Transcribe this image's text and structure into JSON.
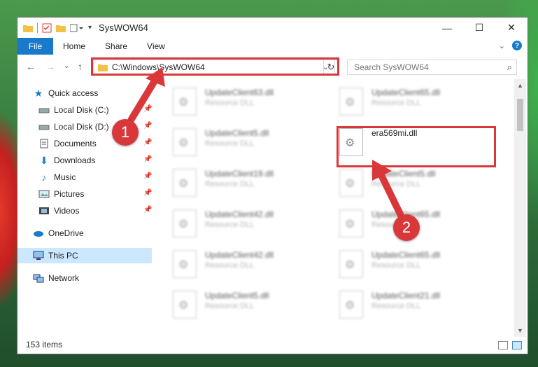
{
  "window": {
    "title": "SysWOW64",
    "buttons": {
      "minimize": "—",
      "maximize": "☐",
      "close": "✕"
    }
  },
  "ribbon": {
    "tabs": [
      "File",
      "Home",
      "Share",
      "View"
    ]
  },
  "address": {
    "path": "C:\\Windows\\SysWOW64",
    "search_placeholder": "Search SysWOW64"
  },
  "nav": {
    "items": [
      {
        "label": "Quick access",
        "icon": "star-icon"
      },
      {
        "label": "Local Disk (C:)",
        "icon": "drive-icon"
      },
      {
        "label": "Local Disk (D:)",
        "icon": "drive-icon"
      },
      {
        "label": "Documents",
        "icon": "documents-icon"
      },
      {
        "label": "Downloads",
        "icon": "downloads-icon"
      },
      {
        "label": "Music",
        "icon": "music-icon"
      },
      {
        "label": "Pictures",
        "icon": "pictures-icon"
      },
      {
        "label": "Videos",
        "icon": "videos-icon"
      },
      {
        "label": "OneDrive",
        "icon": "cloud-icon"
      },
      {
        "label": "This PC",
        "icon": "computer-icon"
      },
      {
        "label": "Network",
        "icon": "network-icon"
      }
    ]
  },
  "files": [
    {
      "name": "UpdateClient63.dll",
      "type": "Resource DLL"
    },
    {
      "name": "UpdateClient65.dll",
      "type": "Resource DLL"
    },
    {
      "name": "UpdateClient5.dll",
      "type": "Resource DLL"
    },
    {
      "name": "era569mi.dll",
      "type": ""
    },
    {
      "name": "UpdateClient19.dll",
      "type": "Resource DLL"
    },
    {
      "name": "UpdateClient5.dll",
      "type": "Resource DLL"
    },
    {
      "name": "UpdateClient42.dll",
      "type": "Resource DLL"
    },
    {
      "name": "UpdateClient65.dll",
      "type": "Resource DLL"
    },
    {
      "name": "UpdateClient42.dll",
      "type": "Resource DLL"
    },
    {
      "name": "UpdateClient65.dll",
      "type": "Resource DLL"
    },
    {
      "name": "UpdateClient5.dll",
      "type": "Resource DLL"
    },
    {
      "name": "UpdateClient21.dll",
      "type": "Resource DLL"
    }
  ],
  "status": {
    "count": "153 items"
  },
  "annotations": {
    "step1": "1",
    "step2": "2"
  },
  "colors": {
    "accent": "#1979ca",
    "highlight": "#d9383b",
    "selection": "#cce8ff"
  }
}
